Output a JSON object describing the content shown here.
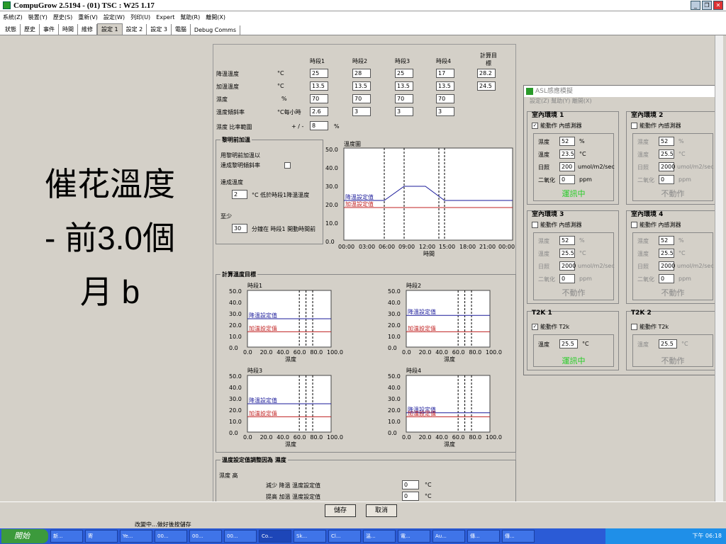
{
  "window": {
    "title": "CompuGrow 2.5194 - (01) TSC : W25 1.17"
  },
  "menu": [
    "系統(Z)",
    "裝置(Y)",
    "歷史(S)",
    "重新(V)",
    "設定(W)",
    "列印(U)",
    "Expert",
    "幫助(R)",
    "離開(X)"
  ],
  "tabs": [
    "狀態",
    "歷史",
    "事件",
    "時間",
    "維修",
    "設定 1",
    "設定 2",
    "設定 3",
    "電腦",
    "Debug Comms"
  ],
  "overlay": {
    "line1": "催花溫度",
    "line2": "- 前3.0個",
    "line3": "月 b"
  },
  "settings": {
    "period_headers": [
      "時段1",
      "時段2",
      "時段3",
      "時段4",
      "計算目標"
    ],
    "rows": [
      {
        "label": "降溫溫度",
        "unit": "°C",
        "values": [
          "25",
          "28",
          "25",
          "17",
          "28.2"
        ]
      },
      {
        "label": "加溫溫度",
        "unit": "°C",
        "values": [
          "13.5",
          "13.5",
          "13.5",
          "13.5",
          "24.5"
        ]
      },
      {
        "label": "濕度",
        "unit": "%",
        "values": [
          "70",
          "70",
          "70",
          "70",
          ""
        ]
      },
      {
        "label": "溫度傾斜率",
        "unit": "°C每小時",
        "values": [
          "2.6",
          "3",
          "3",
          "3",
          ""
        ]
      }
    ],
    "humidity_range_label": "濕度 比率範圍",
    "humidity_range_prefix": "+ / -",
    "humidity_range_value": "8",
    "humidity_range_unit": "%"
  },
  "dawn": {
    "title": "黎明前加溫",
    "desc1": "用黎明前加溫以",
    "desc2": "達成黎明傾斜率",
    "temp_label": "達成溫度",
    "temp_value": "2",
    "temp_desc": "°C 低於時段1降溫溫度",
    "min_label": "至少",
    "min_value": "30",
    "min_desc": "分鐘在 時段1 開動時間前"
  },
  "temp_chart": {
    "title": "溫度圖",
    "xlabel": "時間",
    "cool_label": "降溫設定值",
    "heat_label": "加溫設定值",
    "yticks": [
      "50.0",
      "40.0",
      "30.0",
      "20.0",
      "10.0",
      "0.0"
    ],
    "xticks": [
      "00:00",
      "03:00",
      "06:00",
      "09:00",
      "12:00",
      "15:00",
      "18:00",
      "21:00",
      "00:00"
    ]
  },
  "calc": {
    "title": "計算溫度目標",
    "charts": [
      {
        "title": "時段1",
        "xlabel": "濕度"
      },
      {
        "title": "時段2",
        "xlabel": "濕度"
      },
      {
        "title": "時段3",
        "xlabel": "濕度"
      },
      {
        "title": "時段4",
        "xlabel": "濕度"
      }
    ],
    "cool_label": "降溫設定值",
    "heat_label": "加溫設定值",
    "yticks": [
      "50.0",
      "40.0",
      "30.0",
      "20.0",
      "10.0",
      "0.0"
    ],
    "xticks": [
      "0.0",
      "20.0",
      "40.0",
      "60.0",
      "80.0",
      "100.0"
    ]
  },
  "adjust": {
    "title": "溫度設定值調整因為 濕度",
    "sub": "濕度 高",
    "row1": "減少 降溫 溫度設定值",
    "row2": "提高 加溫 溫度設定值",
    "v1": "0",
    "v2": "0",
    "unit": "°C"
  },
  "sensor": {
    "title": "ASL感應模擬",
    "menu": "設定(Z)  幫助(Y)  離開(X)",
    "zones": [
      {
        "name": "室內環境 1",
        "enable": "能動作 內感測器",
        "checked": "✓",
        "temp": "52",
        "hum": "23.5",
        "light": "200",
        "co2": "0",
        "status": "運訊中",
        "active": true
      },
      {
        "name": "室內環境 2",
        "enable": "能動作 內感測器",
        "checked": "",
        "temp": "52",
        "hum": "25.5",
        "light": "2000",
        "co2": "0",
        "status": "不動作",
        "active": false
      },
      {
        "name": "室內環境 3",
        "enable": "能動作 內感測器",
        "checked": "",
        "temp": "52",
        "hum": "25.5",
        "light": "2000",
        "co2": "0",
        "status": "不動作",
        "active": false
      },
      {
        "name": "室內環境 4",
        "enable": "能動作 內感測器",
        "checked": "",
        "temp": "52",
        "hum": "25.5",
        "light": "2000",
        "co2": "0",
        "status": "不動作",
        "active": false
      }
    ],
    "labels": {
      "temp": "濕度",
      "hum": "溫度",
      "light": "日照",
      "co2": "二氧化",
      "u_temp": "%",
      "u_hum": "°C",
      "u_light": "umol/m2/sec",
      "u_co2": "ppm"
    },
    "t2k": [
      {
        "name": "T2K 1",
        "enable": "能動作 T2k",
        "checked": "✓",
        "label": "溫度",
        "value": "25.5",
        "unit": "°C",
        "status": "運訊中",
        "active": true
      },
      {
        "name": "T2K 2",
        "enable": "能動作 T2k",
        "checked": "",
        "label": "溫度",
        "value": "25.5",
        "unit": "°C",
        "status": "不動作",
        "active": false
      }
    ]
  },
  "buttons": {
    "save": "儲存",
    "cancel": "取消"
  },
  "status": {
    "text": "改變中...做好後按儲存"
  },
  "taskbar": {
    "start": "開始",
    "items": [
      "新...",
      "寄",
      "Ye...",
      "00...",
      "00...",
      "00...",
      "Co...",
      "Sk...",
      "Cl...",
      "溫...",
      "電...",
      "Au...",
      "傳...",
      "傳..."
    ],
    "clock": "下午 06:18"
  },
  "colors": {
    "cool": "#1a1a9a",
    "heat": "#c02020"
  }
}
